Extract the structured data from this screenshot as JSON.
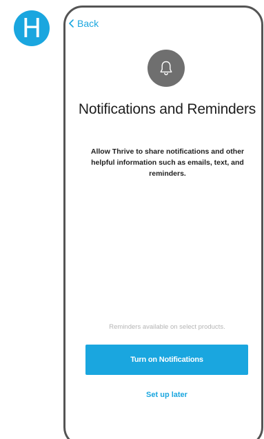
{
  "step": {
    "letter": "H"
  },
  "nav": {
    "back_label": "Back"
  },
  "icons": {
    "back": "chevron-left-icon",
    "bell": "bell-icon"
  },
  "content": {
    "title": "Notifications and Reminders",
    "description": "Allow Thrive to share notifications and other helpful information such as emails, text, and reminders.",
    "footnote": "Reminders available on select products."
  },
  "actions": {
    "primary_label": "Turn on Notifications",
    "secondary_label": "Set up later"
  },
  "colors": {
    "accent": "#1aa6df",
    "icon_bg": "#6f6f6f",
    "frame": "#545454",
    "text": "#1e1e1e",
    "muted": "#b4b4b4"
  }
}
